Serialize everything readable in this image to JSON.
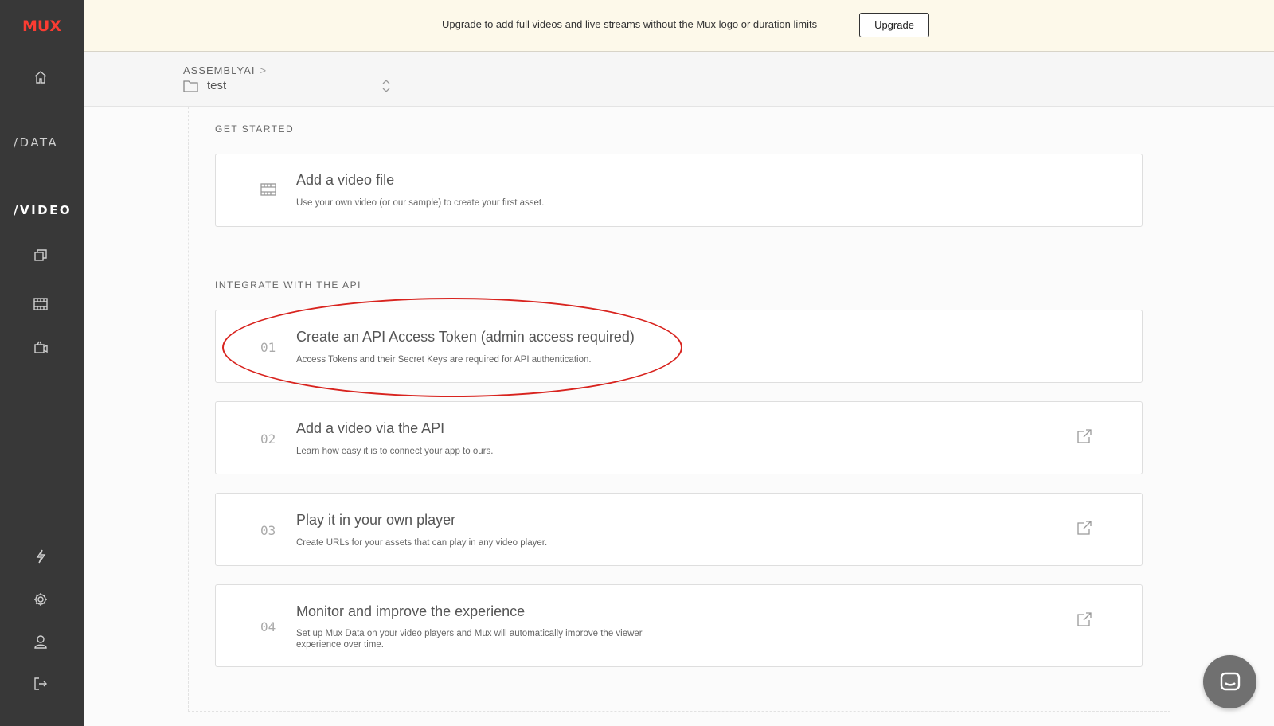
{
  "sidebar": {
    "logo": "MUX",
    "data_label": "/DATA",
    "video_label": "/VIDEO",
    "icons": [
      "home-icon",
      "assets-icon",
      "video-film-icon",
      "live-stream-icon",
      "lightning-icon",
      "gear-icon",
      "user-icon",
      "logout-icon"
    ]
  },
  "banner": {
    "text": "Upgrade to add full videos and live streams without the Mux logo or duration limits",
    "button_label": "Upgrade"
  },
  "breadcrumb": {
    "org": "ASSEMBLYAI",
    "separator": ">",
    "environment": "test"
  },
  "get_started": {
    "title": "GET STARTED",
    "card": {
      "title": "Add a video file",
      "description": "Use your own video (or our sample) to create your first asset."
    }
  },
  "integrate": {
    "title": "INTEGRATE WITH THE API",
    "steps": [
      {
        "number": "01",
        "title": "Create an API Access Token (admin access required)",
        "description": "Access Tokens and their Secret Keys are required for API authentication."
      },
      {
        "number": "02",
        "title": "Add a video via the API",
        "description": "Learn how easy it is to connect your app to ours."
      },
      {
        "number": "03",
        "title": "Play it in your own player",
        "description": "Create URLs for your assets that can play in any video player."
      },
      {
        "number": "04",
        "title": "Monitor and improve the experience",
        "description": "Set up Mux Data on your video players and Mux will automatically improve the viewer experience over time."
      }
    ]
  },
  "annotation": {
    "color": "#d8231e"
  },
  "colors": {
    "sidebar_bg": "#383838",
    "brand": "#fa3c32",
    "banner_bg": "#fdf9ea"
  }
}
